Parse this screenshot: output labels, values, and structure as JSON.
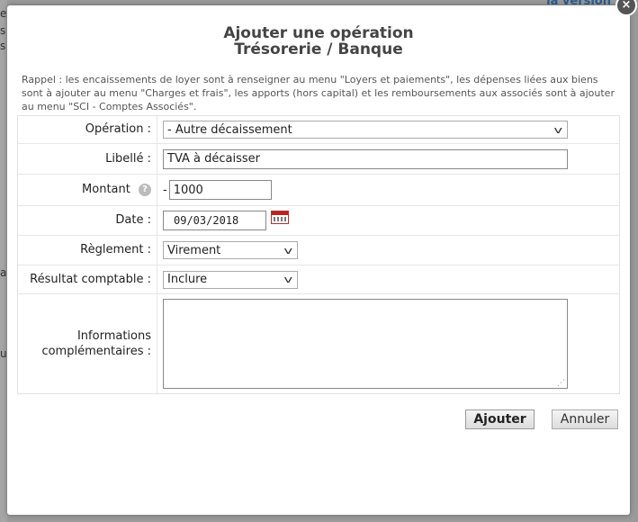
{
  "background": {
    "top_link": "la version",
    "edge_letters": [
      "e",
      "s",
      "s",
      "a",
      "u"
    ]
  },
  "dialog": {
    "close": "×",
    "title_line1": "Ajouter une opération",
    "title_line2": "Trésorerie / Banque",
    "note": "Rappel : les encaissements de loyer sont à renseigner au menu \"Loyers et paiements\", les dépenses liées aux biens sont à ajouter au menu \"Charges et frais\", les apports (hors capital) et les remboursements aux associés sont à ajouter au menu \"SCI - Comptes Associés\".",
    "fields": {
      "operation": {
        "label": "Opération :",
        "value": "- Autre décaissement"
      },
      "libelle": {
        "label": "Libellé :",
        "value": "TVA à décaisser"
      },
      "montant": {
        "label": "Montant",
        "help": "?",
        "sign": "-",
        "value": "1000"
      },
      "date": {
        "label": "Date :",
        "value": "09/03/2018"
      },
      "reglement": {
        "label": "Règlement :",
        "value": "Virement"
      },
      "resultat": {
        "label": "Résultat comptable :",
        "value": "Inclure"
      },
      "infos": {
        "label_line1": "Informations",
        "label_line2": "complémentaires :",
        "value": ""
      }
    },
    "buttons": {
      "submit": "Ajouter",
      "cancel": "Annuler"
    }
  }
}
